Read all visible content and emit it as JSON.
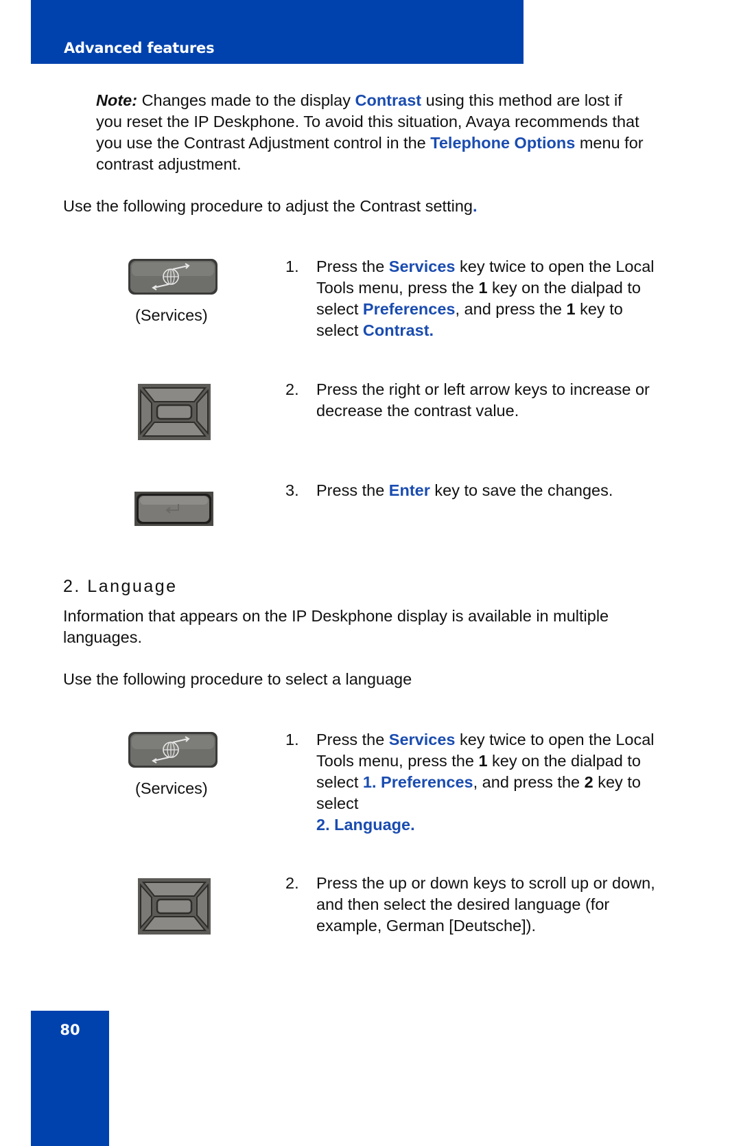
{
  "header": {
    "title": "Advanced features"
  },
  "note": {
    "label": "Note:",
    "t1": " Changes made to the display ",
    "link1": "Contrast",
    "t2": " using this method are lost if you reset the IP Deskphone. To avoid this situation, Avaya recommends that you use the Contrast Adjustment control in the ",
    "link2": "Telephone Options",
    "t3": " menu for contrast adjustment."
  },
  "contrast_intro": {
    "text": "Use the following procedure to adjust the Contrast setting",
    "period": "."
  },
  "contrast_steps": [
    {
      "num": "1.",
      "key_caption": "(Services)",
      "key_icon": "services-key-icon",
      "parts": {
        "a": "Press the ",
        "b": "Services",
        "c": " key twice to open the Local Tools menu, press the ",
        "d": "1",
        "e": " key on the dialpad to select ",
        "f": "Preferences",
        "g": ", and press the ",
        "h": "1",
        "i": " key to select ",
        "j": "Contrast."
      }
    },
    {
      "num": "2.",
      "key_icon": "navigation-cluster-icon",
      "text": "Press the right or left arrow keys to increase or decrease the contrast value."
    },
    {
      "num": "3.",
      "key_icon": "enter-key-icon",
      "parts": {
        "a": "Press the ",
        "b": "Enter",
        "c": " key to save the changes."
      }
    }
  ],
  "language_section": {
    "heading": "2. Language",
    "intro": "Information that appears on the IP Deskphone display is available in multiple languages.",
    "procedure_intro": "Use the following procedure to select a language",
    "steps": [
      {
        "num": "1.",
        "key_caption": "(Services)",
        "key_icon": "services-key-icon",
        "parts": {
          "a": "Press the ",
          "b": "Services",
          "c": " key twice to open the Local Tools menu, press the ",
          "d": "1",
          "e": " key on the dialpad to select ",
          "f": "1. Preferences",
          "g": ", and press the ",
          "h": "2",
          "i": " key to select",
          "j": "2. Language."
        }
      },
      {
        "num": "2.",
        "key_icon": "navigation-cluster-icon",
        "text": "Press the up or down keys to scroll up or down, and then select the desired language (for example, German [Deutsche])."
      }
    ]
  },
  "footer": {
    "page_number": "80"
  },
  "colors": {
    "brand_blue": "#0042ad",
    "link_blue": "#1a4cb0"
  }
}
